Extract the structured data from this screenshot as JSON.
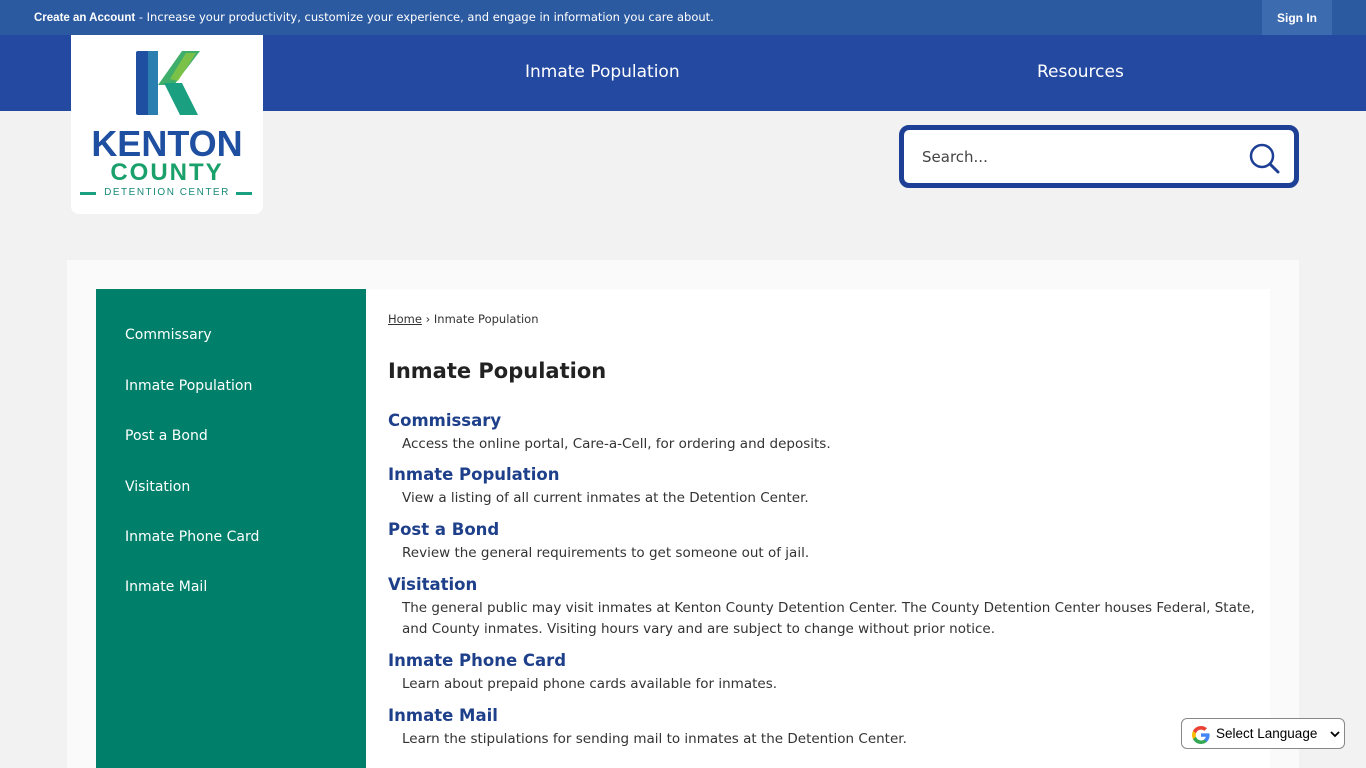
{
  "topbar": {
    "create_account": "Create an Account",
    "message": " - Increase your productivity, customize your experience, and engage in information you care about.",
    "sign_in": "Sign In"
  },
  "logo": {
    "line1": "KENTON",
    "line2": "COUNTY",
    "line3": "DETENTION CENTER"
  },
  "nav": {
    "items": [
      "Inmate Population",
      "Resources"
    ]
  },
  "search": {
    "placeholder": "Search..."
  },
  "sidebar": {
    "items": [
      "Commissary",
      "Inmate Population",
      "Post a Bond",
      "Visitation",
      "Inmate Phone Card",
      "Inmate Mail"
    ]
  },
  "breadcrumb": {
    "home": "Home",
    "separator": "›",
    "current": "Inmate Population"
  },
  "main": {
    "title": "Inmate Population",
    "entries": [
      {
        "title": "Commissary",
        "desc": "Access the online portal, Care-a-Cell, for ordering and deposits."
      },
      {
        "title": "Inmate Population",
        "desc": "View a listing of all current inmates at the Detention Center."
      },
      {
        "title": "Post a Bond",
        "desc": "Review the general requirements to get someone out of jail."
      },
      {
        "title": "Visitation",
        "desc": "The general public may visit inmates at Kenton County Detention Center. The County Detention Center houses Federal, State, and County inmates. Visiting hours vary and are subject to change without prior notice."
      },
      {
        "title": "Inmate Phone Card",
        "desc": "Learn about prepaid phone cards available for inmates."
      },
      {
        "title": "Inmate Mail",
        "desc": "Learn the stipulations for sending mail to inmates at the Detention Center."
      }
    ]
  },
  "language": {
    "label": "Select Language"
  },
  "colors": {
    "topbar": "#2c5aa0",
    "navbar": "#2449a0",
    "sidebar": "#00806a",
    "link": "#1e3f8a"
  },
  "icons": {
    "search": "search-icon",
    "google": "google-g-icon",
    "dropdown": "chevron-down-icon",
    "logo": "kenton-k-logo-icon"
  }
}
